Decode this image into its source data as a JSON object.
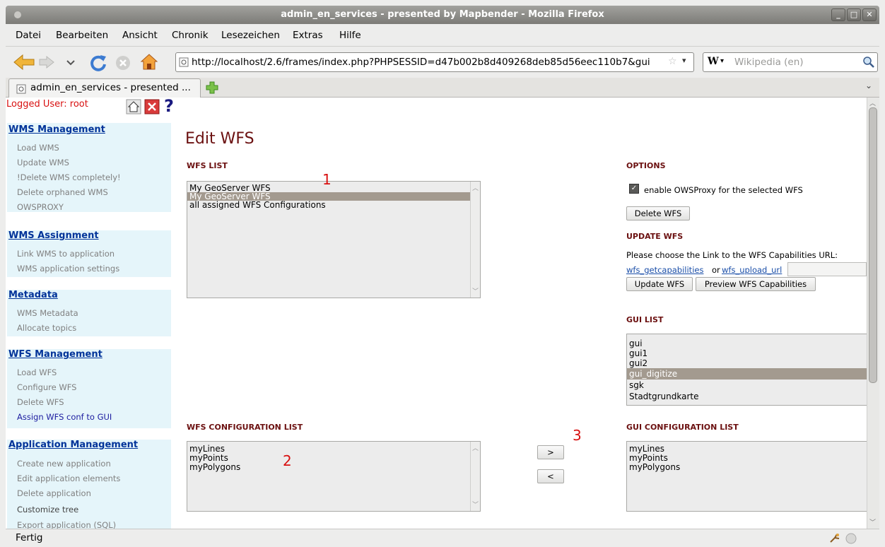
{
  "window": {
    "title": "admin_en_services - presented by Mapbender - Mozilla Firefox",
    "controls": [
      "_",
      "□",
      "✕"
    ]
  },
  "menu": [
    "Datei",
    "Bearbeiten",
    "Ansicht",
    "Chronik",
    "Lesezeichen",
    "Extras",
    "Hilfe"
  ],
  "nav": {
    "url": "http://localhost/2.6/frames/index.php?PHPSESSID=d47b002b8d409268deb85d56eec110b7&gui",
    "search_placeholder": "Wikipedia (en)",
    "search_engine": "W"
  },
  "tab": {
    "label": "admin_en_services - presented ..."
  },
  "status": {
    "text": "Fertig"
  },
  "header": {
    "logged_user": "Logged User: root"
  },
  "sidebar": {
    "sections": [
      {
        "title": "WMS Management",
        "items": [
          "Load WMS",
          "Update WMS",
          "!Delete WMS completely!",
          "Delete orphaned WMS",
          "OWSPROXY"
        ]
      },
      {
        "title": "WMS Assignment",
        "items": [
          "Link WMS to application",
          "WMS application settings"
        ]
      },
      {
        "title": "Metadata",
        "items": [
          "WMS Metadata",
          "Allocate topics"
        ]
      },
      {
        "title": "WFS Management",
        "items": [
          "Load WFS",
          "Configure WFS",
          "Delete WFS",
          "Assign WFS conf to GUI"
        ]
      },
      {
        "title": "Application Management",
        "items": [
          "Create new application",
          "Edit application elements",
          "Delete application",
          "Customize tree",
          "Export application (SQL)"
        ]
      }
    ]
  },
  "main": {
    "title": "Edit WFS",
    "wfs_list": {
      "label": "WFS LIST",
      "options": [
        "My GeoServer WFS",
        "My GeoServer WFS",
        "all assigned WFS Configurations"
      ],
      "selected_index": 1
    },
    "options": {
      "label": "OPTIONS",
      "checkbox_label": "enable OWSProxy for the selected WFS",
      "checked": true,
      "delete_button": "Delete WFS"
    },
    "update": {
      "label": "UPDATE WFS",
      "prompt": "Please choose the Link to the WFS Capabilities URL:",
      "link1": "wfs_getcapabilities",
      "or": "or",
      "link2": "wfs_upload_url",
      "update_button": "Update WFS",
      "preview_button": "Preview WFS Capabilities"
    },
    "gui_list": {
      "label": "GUI LIST",
      "options": [
        "gui",
        "gui1",
        "gui2",
        "gui_digitize",
        "sgk",
        "Stadtgrundkarte"
      ],
      "selected_index": 3
    },
    "wfs_conf_list": {
      "label": "WFS CONFIGURATION LIST",
      "options": [
        "myLines",
        "myPoints",
        "myPolygons"
      ]
    },
    "gui_conf_list": {
      "label": "GUI CONFIGURATION LIST",
      "options": [
        "myLines",
        "myPoints",
        "myPolygons"
      ]
    },
    "move_right": ">",
    "move_left": "<",
    "annotations": [
      "1",
      "2",
      "3"
    ]
  }
}
